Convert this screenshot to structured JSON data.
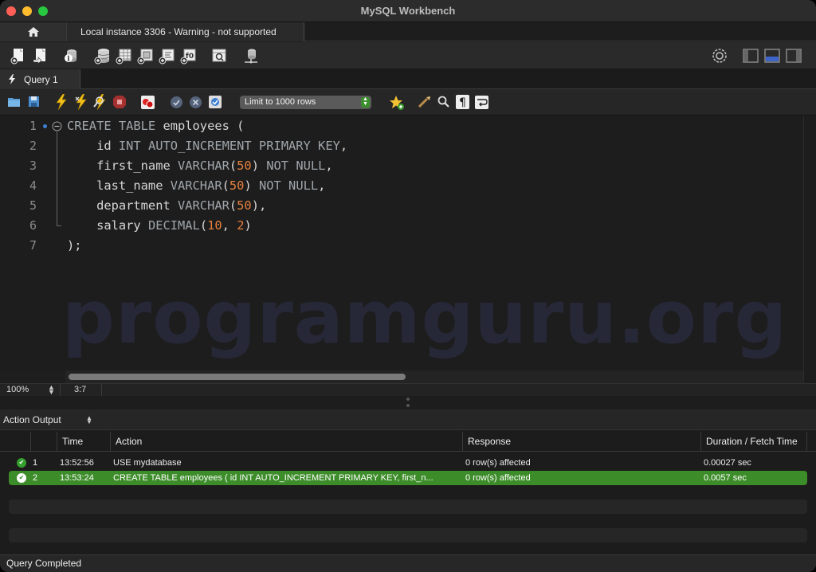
{
  "window": {
    "title": "MySQL Workbench"
  },
  "connection_tabs": {
    "home_icon": "home-icon",
    "active_tab": "Local instance 3306 - Warning - not supported"
  },
  "main_toolbar": {
    "icons": [
      "new-sql-tab-icon",
      "open-sql-script-icon",
      "inspector-icon",
      "create-schema-icon",
      "create-table-icon",
      "create-view-icon",
      "create-procedure-icon",
      "create-function-icon",
      "search-table-data-icon",
      "reconnect-icon"
    ],
    "layout_icons": [
      "settings-icon",
      "toggle-sidebar-icon",
      "toggle-output-icon",
      "toggle-secondary-sidebar-icon"
    ]
  },
  "query_tab": {
    "label": "Query 1",
    "icon": "lightning-icon"
  },
  "sql_toolbar": {
    "limit_select": "Limit to 1000 rows",
    "icons": [
      "open-file-icon",
      "save-icon",
      "execute-icon",
      "execute-current-icon",
      "explain-icon",
      "stop-icon",
      "toggle-continue-on-error-icon",
      "commit-icon",
      "rollback-icon",
      "autocommit-icon",
      "add-snippet-icon",
      "beautify-icon",
      "find-icon",
      "invisible-chars-icon",
      "wrap-lines-icon"
    ]
  },
  "editor": {
    "line_numbers": [
      "1",
      "2",
      "3",
      "4",
      "5",
      "6",
      "7"
    ],
    "lines": [
      [
        {
          "t": "CREATE TABLE",
          "c": "kw"
        },
        {
          "t": " employees (",
          "c": ""
        }
      ],
      [
        {
          "t": "    id ",
          "c": ""
        },
        {
          "t": "INT AUTO_INCREMENT PRIMARY KEY",
          "c": "kw"
        },
        {
          "t": ",",
          "c": ""
        }
      ],
      [
        {
          "t": "    first_name ",
          "c": ""
        },
        {
          "t": "VARCHAR",
          "c": "kw"
        },
        {
          "t": "(",
          "c": ""
        },
        {
          "t": "50",
          "c": "num"
        },
        {
          "t": ") ",
          "c": ""
        },
        {
          "t": "NOT NULL",
          "c": "kw"
        },
        {
          "t": ",",
          "c": ""
        }
      ],
      [
        {
          "t": "    last_name ",
          "c": ""
        },
        {
          "t": "VARCHAR",
          "c": "kw"
        },
        {
          "t": "(",
          "c": ""
        },
        {
          "t": "50",
          "c": "num"
        },
        {
          "t": ") ",
          "c": ""
        },
        {
          "t": "NOT NULL",
          "c": "kw"
        },
        {
          "t": ",",
          "c": ""
        }
      ],
      [
        {
          "t": "    department ",
          "c": ""
        },
        {
          "t": "VARCHAR",
          "c": "kw"
        },
        {
          "t": "(",
          "c": ""
        },
        {
          "t": "50",
          "c": "num"
        },
        {
          "t": "),",
          "c": ""
        }
      ],
      [
        {
          "t": "    salary ",
          "c": ""
        },
        {
          "t": "DECIMAL",
          "c": "kw"
        },
        {
          "t": "(",
          "c": ""
        },
        {
          "t": "10",
          "c": "num"
        },
        {
          "t": ", ",
          "c": ""
        },
        {
          "t": "2",
          "c": "num"
        },
        {
          "t": ")",
          "c": ""
        }
      ],
      [
        {
          "t": ");",
          "c": ""
        }
      ]
    ],
    "watermark": "programguru.org",
    "zoom": "100%",
    "cursor_position": "3:7"
  },
  "output": {
    "selector": "Action Output",
    "columns": [
      "",
      "",
      "Time",
      "Action",
      "Response",
      "Duration / Fetch Time"
    ],
    "rows": [
      {
        "status_icon": "success-check-icon",
        "index": "1",
        "time": "13:52:56",
        "action": "USE mydatabase",
        "response": "0 row(s) affected",
        "duration": "0.00027 sec",
        "selected": false
      },
      {
        "status_icon": "success-check-icon",
        "index": "2",
        "time": "13:53:24",
        "action": "CREATE TABLE employees (     id INT AUTO_INCREMENT PRIMARY KEY,     first_n...",
        "response": "0 row(s) affected",
        "duration": "0.0057 sec",
        "selected": true
      }
    ]
  },
  "status_bar": {
    "text": "Query Completed"
  },
  "colors": {
    "accent_green": "#3c8c29",
    "number": "#e5803e",
    "keyword": "#a0a6ab",
    "watermark": "#262838"
  }
}
